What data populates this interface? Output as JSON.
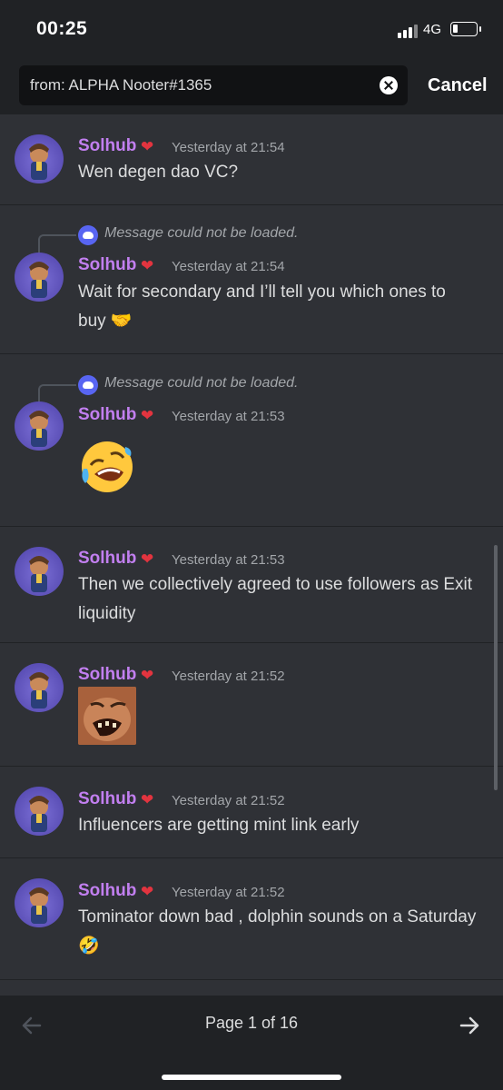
{
  "status": {
    "time": "00:25",
    "network": "4G"
  },
  "search": {
    "query": "from: ALPHA Nooter#1365",
    "cancel_label": "Cancel"
  },
  "messages": [
    {
      "author": "Solhub",
      "timestamp": "Yesterday at 21:54",
      "text": "Wen degen dao VC?"
    },
    {
      "reply_text": "Message could not be loaded.",
      "author": "Solhub",
      "timestamp": "Yesterday at 21:54",
      "text": "Wait for secondary and I’ll tell you which ones to buy 🤝"
    },
    {
      "reply_text": "Message could not be loaded.",
      "author": "Solhub",
      "timestamp": "Yesterday at 21:53",
      "emoji": "rolling-on-floor-laughing"
    },
    {
      "author": "Solhub",
      "timestamp": "Yesterday at 21:53",
      "text": "Then we collectively agreed to use followers as Exit liquidity"
    },
    {
      "author": "Solhub",
      "timestamp": "Yesterday at 21:52",
      "sticker": "laughing-man-sticker"
    },
    {
      "author": "Solhub",
      "timestamp": "Yesterday at 21:52",
      "text": "Influencers are getting mint link early"
    },
    {
      "author": "Solhub",
      "timestamp": "Yesterday at 21:52",
      "text": "Tominator down bad , dolphin sounds on a Saturday 🤣"
    }
  ],
  "pagination": {
    "label": "Page 1 of 16"
  },
  "colors": {
    "background": "#2f3136",
    "username": "#c27ff0",
    "accent": "#5865f2"
  }
}
